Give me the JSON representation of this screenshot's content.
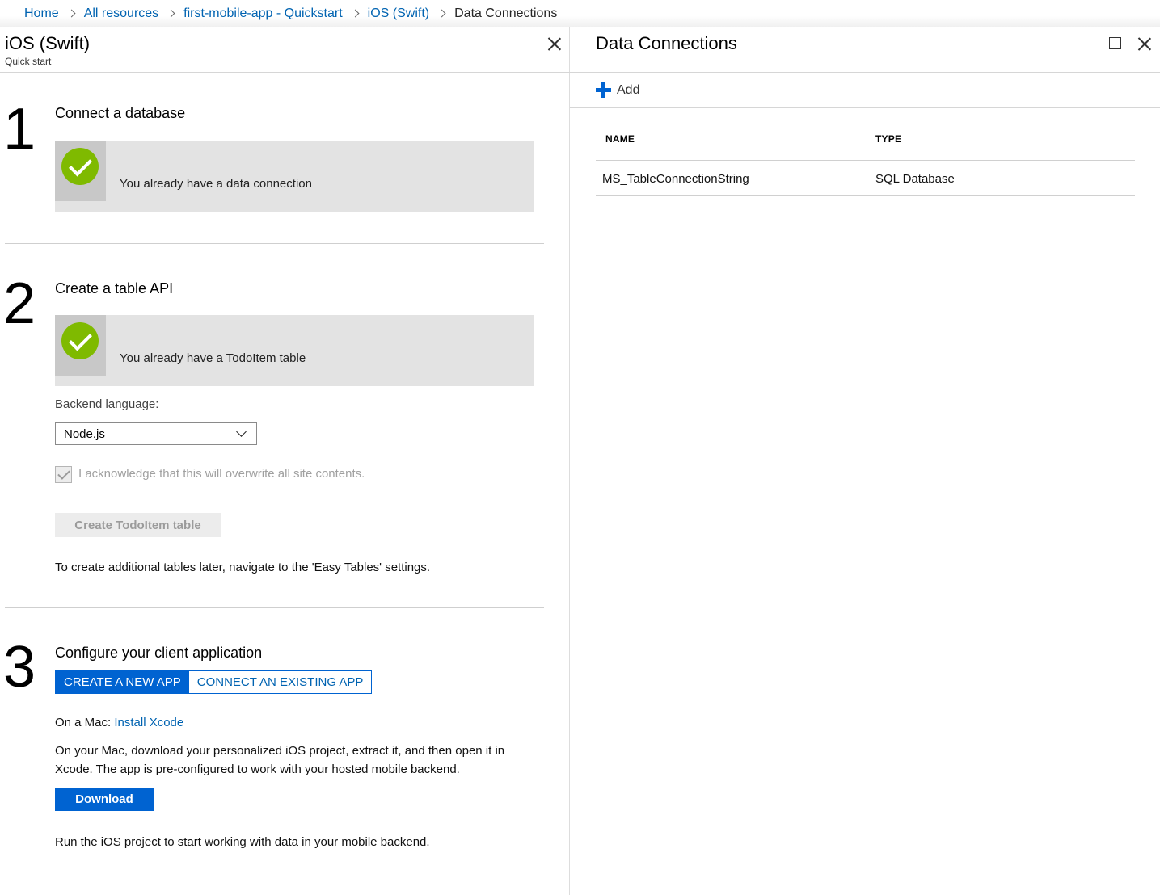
{
  "breadcrumb": {
    "items": [
      "Home",
      "All resources",
      "first-mobile-app - Quickstart",
      "iOS (Swift)"
    ],
    "current": "Data Connections"
  },
  "left_blade": {
    "title": "iOS (Swift)",
    "subtitle": "Quick start",
    "step1": {
      "number": "1",
      "title": "Connect a database",
      "status": "You already have a data connection"
    },
    "step2": {
      "number": "2",
      "title": "Create a table API",
      "status": "You already have a TodoItem table",
      "backend_label": "Backend language:",
      "backend_value": "Node.js",
      "acknowledge": "I acknowledge that this will overwrite all site contents.",
      "create_button": "Create TodoItem table",
      "note": "To create additional tables later, navigate to the 'Easy Tables' settings."
    },
    "step3": {
      "number": "3",
      "title": "Configure your client application",
      "tabs": [
        "CREATE A NEW APP",
        "CONNECT AN EXISTING APP"
      ],
      "mac_prefix": "On a Mac: ",
      "mac_link": "Install Xcode",
      "instructions": "On your Mac, download your personalized iOS project, extract it, and then open it in Xcode. The app is pre-configured to work with your hosted mobile backend.",
      "download_button": "Download",
      "run_text": "Run the iOS project to start working with data in your mobile backend."
    }
  },
  "right_blade": {
    "title": "Data Connections",
    "add_label": "Add",
    "columns": [
      "NAME",
      "TYPE"
    ],
    "rows": [
      {
        "name": "MS_TableConnectionString",
        "type": "SQL Database"
      }
    ]
  },
  "colors": {
    "accent": "#0063d1",
    "link": "#0063b1",
    "success": "#7fba00"
  }
}
